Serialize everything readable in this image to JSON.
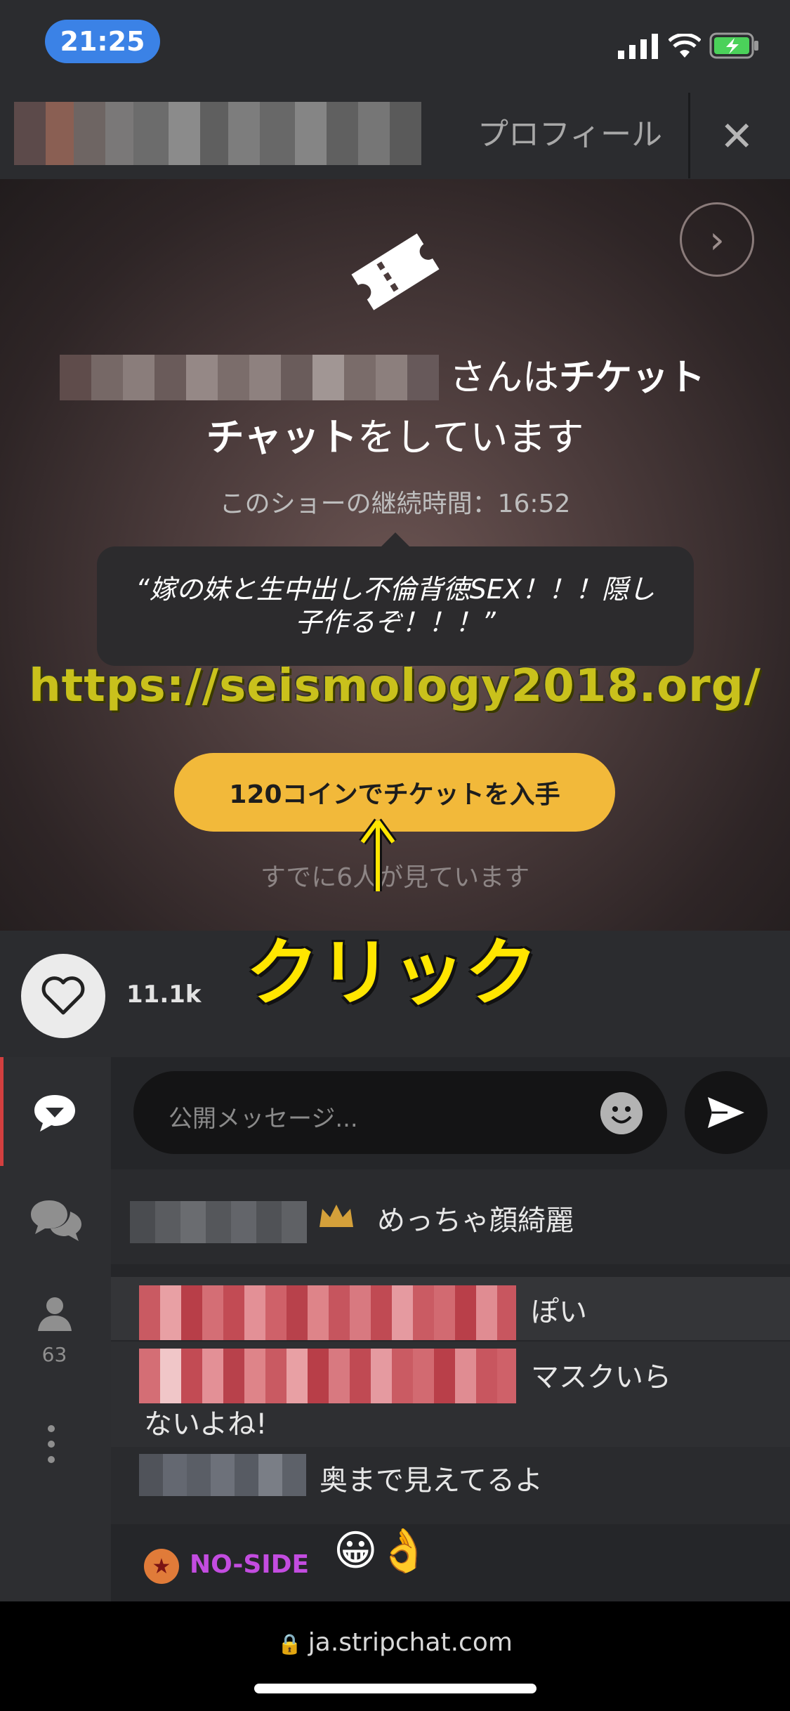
{
  "status": {
    "time": "21:25"
  },
  "header": {
    "profile_label": "プロフィール",
    "close_label": "✕"
  },
  "show": {
    "title_suffix_plain": "さんは",
    "title_suffix_bold": "チケット",
    "line2_bold": "チャット",
    "line2_plain": "をしています",
    "duration": "このショーの継続時間：16:52",
    "topic": "“嫁の妹と生中出し不倫背徳SEX！！！隠し子作るぞ！！！”",
    "buy_button": "120コインでチケットを入手",
    "viewers": "すでに6人が見ています"
  },
  "overlay": {
    "url": "https://seismology2018.org/",
    "click": "クリック"
  },
  "likes": {
    "count": "11.1k"
  },
  "sidebar": {
    "user_count": "63"
  },
  "chat": {
    "placeholder": "公開メッセージ...",
    "messages": [
      {
        "text": "めっちゃ顔綺麗"
      },
      {
        "text": "ぽい"
      },
      {
        "text_a": "マスクいら",
        "text_b": "ないよね!"
      },
      {
        "text": "奥まで見えてるよ"
      }
    ],
    "last_user": "NO-SIDE",
    "last_emoji": "😀👌"
  },
  "browser": {
    "domain": "ja.stripchat.com"
  },
  "colors": {
    "accent": "#f2b93a",
    "active_tab": "#d23f3f",
    "url_overlay": "#c9c11c",
    "click_label": "#ffe600"
  }
}
